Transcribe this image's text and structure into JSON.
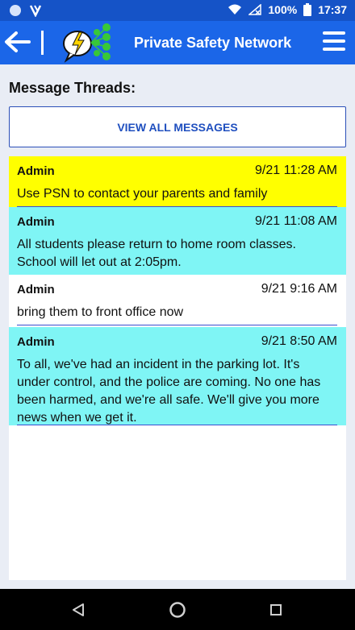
{
  "status": {
    "battery": "100%",
    "time": "17:37"
  },
  "appbar": {
    "title": "Private Safety Network"
  },
  "heading": "Message Threads:",
  "view_all_label": "VIEW ALL MESSAGES",
  "threads": [
    {
      "sender": "Admin",
      "time": "9/21 11:28 AM",
      "message": "Use PSN to contact your parents and family",
      "color": "#ffff00"
    },
    {
      "sender": "Admin",
      "time": "9/21 11:08 AM",
      "message": "All students please return to home room classes. School will let out at 2:05pm.",
      "color": "#7ff5f5"
    },
    {
      "sender": "Admin",
      "time": "9/21 9:16 AM",
      "message": "bring them to front office now",
      "color": "#ffffff"
    },
    {
      "sender": "Admin",
      "time": "9/21 8:50 AM",
      "message": "To all, we've had an incident in the parking lot. It's under control, and the police are coming. No one has been harmed, and we're all safe. We'll give you more news when we get it.",
      "color": "#7ff5f5"
    }
  ],
  "colors": {
    "statusbar": "#1553c7",
    "appbar": "#1b66e8",
    "accent": "#1f4fbf"
  }
}
